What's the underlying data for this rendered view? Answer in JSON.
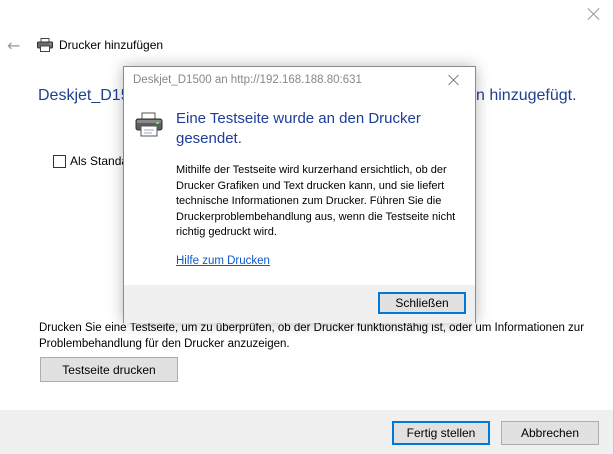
{
  "wizard": {
    "title": "Drucker hinzufügen",
    "heading_left": "Deskjet_D15",
    "heading_right": "n hinzugefügt.",
    "checkbox_label": "Als Standa",
    "info_text": "Drucken Sie eine Testseite, um zu überprüfen, ob der Drucker funktionsfähig ist, oder um Informationen zur Problembehandlung für den Drucker anzuzeigen.",
    "test_page_button": "Testseite drucken",
    "finish_button": "Fertig stellen",
    "cancel_button": "Abbrechen"
  },
  "dialog": {
    "title": "Deskjet_D1500 an http://192.168.188.80:631",
    "heading": "Eine Testseite wurde an den Drucker gesendet.",
    "body": "Mithilfe der Testseite wird kurzerhand ersichtlich, ob der Drucker Grafiken und Text drucken kann, und sie liefert technische Informationen zum Drucker. Führen Sie die Druckerproblembehandlung aus, wenn die Testseite nicht richtig gedruckt wird.",
    "help_link": "Hilfe zum Drucken",
    "close_button": "Schließen"
  },
  "icons": {
    "back": "back-arrow-icon",
    "printer": "printer-icon",
    "close": "close-icon"
  },
  "colors": {
    "heading": "#1f3f8f",
    "link": "#0b58c9",
    "primary_border": "#0078d7"
  }
}
